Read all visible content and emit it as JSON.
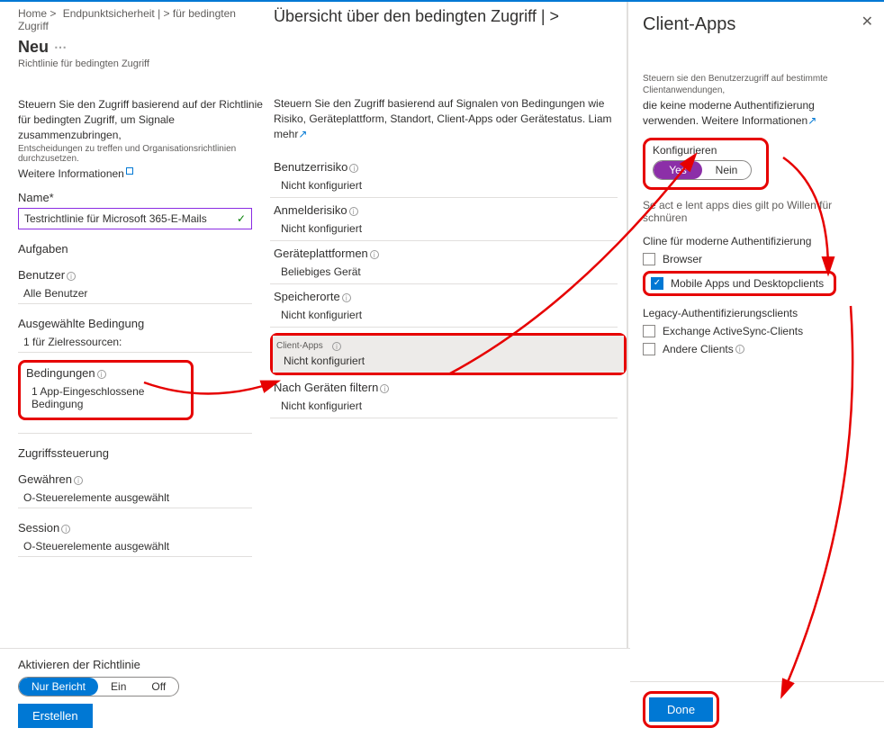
{
  "breadcrumb": {
    "home": "Home >",
    "item1": "Endpunktsicherheit | > für bedingten Zugriff"
  },
  "midTitle": "Übersicht über den bedingten Zugriff | >",
  "pageTitle": "Neu",
  "pageSubtitle": "Richtlinie für bedingten Zugriff",
  "leftDesc1": "Steuern Sie den Zugriff basierend auf der Richtlinie für bedingten Zugriff, um Signale zusammenzubringen,",
  "leftDesc2": "Entscheidungen zu treffen und Organisationsrichtlinien durchzusetzen.",
  "moreInfo": "Weitere Informationen",
  "nameLabel": "Name*",
  "nameValue": "Testrichtlinie für Microsoft 365-E-Mails",
  "tasksHdr": "Aufgaben",
  "usersHdr": "Benutzer",
  "usersVal": "Alle Benutzer",
  "selCondHdr": "Ausgewählte Bedingung",
  "selCondVal": "1 für Zielressourcen:",
  "condHdr": "Bedingungen",
  "condVal": "1 App-Eingeschlossene Bedingung",
  "accessHdr": "Zugriffssteuerung",
  "grantHdr": "Gewähren",
  "grantVal": "O-Steuerelemente ausgewählt",
  "sessionHdr": "Session",
  "sessionVal": "O-Steuerelemente ausgewählt",
  "midDesc": "Steuern Sie den Zugriff basierend auf Signalen von Bedingungen wie Risiko, Geräteplattform, Standort, Client-Apps oder Gerätestatus. Liam mehr",
  "conds": {
    "userRisk": {
      "label": "Benutzerrisiko",
      "val": "Nicht konfiguriert"
    },
    "signinRisk": {
      "label": "Anmelderisiko",
      "val": "Nicht konfiguriert"
    },
    "platforms": {
      "label": "Geräteplattformen",
      "val": "Beliebiges Gerät"
    },
    "locations": {
      "label": "Speicherorte",
      "val": "Nicht konfiguriert"
    },
    "clientApps": {
      "label": "Client-Apps",
      "val": "Nicht konfiguriert"
    },
    "deviceFilter": {
      "label": "Nach Geräten filtern",
      "val": "Nicht konfiguriert"
    }
  },
  "panel": {
    "title": "Client-Apps",
    "desc1": "Steuern sie den Benutzerzugriff auf bestimmte Clientanwendungen,",
    "desc2": "die keine moderne Authentifizierung verwenden. Weitere Informationen",
    "configLabel": "Konfigurieren",
    "yes": "Yes",
    "no": "Nein",
    "note": "Se act e lent apps dies gilt po Willen für schnüren",
    "modernHdr": "Cline für moderne Authentifizierung",
    "browser": "Browser",
    "mobile": "Mobile Apps und Desktopclients",
    "legacyHdr": "Legacy-Authentifizierungsclients",
    "eas": "Exchange ActiveSync-Clients",
    "other": "Andere Clients",
    "done": "Done"
  },
  "bottom": {
    "enableLabel": "Aktivieren der Richtlinie",
    "opt1": "Nur Bericht",
    "opt2": "Ein",
    "opt3": "Off",
    "create": "Erstellen"
  }
}
